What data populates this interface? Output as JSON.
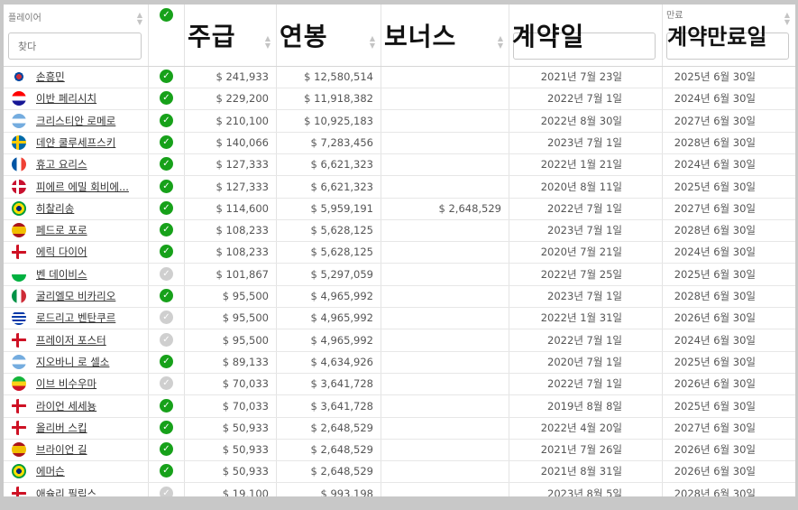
{
  "headers": {
    "player": "플레이어",
    "weekly": "주급",
    "annual": "연봉",
    "bonus": "보너스",
    "contract": "계약일",
    "expiry_small": "만료",
    "expiry": "계약만료일",
    "search_placeholder": "찾다"
  },
  "check_icon": "✓",
  "flag_colors": {
    "kr": [
      "#ffffff",
      "#cd2e3a",
      "#0047a0"
    ],
    "hr": [
      "#ff0000",
      "#ffffff",
      "#171796"
    ],
    "ar": [
      "#74acdf",
      "#ffffff",
      "#74acdf"
    ],
    "se": [
      "#006aa7",
      "#fecc00",
      "#006aa7"
    ],
    "fr": [
      "#0055a4",
      "#ffffff",
      "#ef4135"
    ],
    "dk": [
      "#c8102e",
      "#ffffff",
      "#c8102e"
    ],
    "br": [
      "#009c3b",
      "#ffdf00",
      "#002776"
    ],
    "es": [
      "#aa151b",
      "#f1bf00",
      "#aa151b"
    ],
    "en": [
      "#ffffff",
      "#ce1124",
      "#ffffff"
    ],
    "wl": [
      "#ffffff",
      "#00b140",
      "#d30731"
    ],
    "it": [
      "#009246",
      "#ffffff",
      "#ce2b37"
    ],
    "uy": [
      "#ffffff",
      "#0038a8",
      "#ffffff"
    ],
    "ml": [
      "#14b53a",
      "#fcd116",
      "#ce1126"
    ]
  },
  "rows": [
    {
      "flag": "kr",
      "name": "손흥민",
      "signed": true,
      "weekly": "$ 241,933",
      "annual": "$ 12,580,514",
      "bonus": "",
      "contract": "2021년 7월 23일",
      "expiry": "2025년 6월 30일"
    },
    {
      "flag": "hr",
      "name": "이반 페리시치",
      "signed": true,
      "weekly": "$ 229,200",
      "annual": "$ 11,918,382",
      "bonus": "",
      "contract": "2022년 7월 1일",
      "expiry": "2024년 6월 30일"
    },
    {
      "flag": "ar",
      "name": "크리스티안 로메로",
      "signed": true,
      "weekly": "$ 210,100",
      "annual": "$ 10,925,183",
      "bonus": "",
      "contract": "2022년 8월 30일",
      "expiry": "2027년 6월 30일"
    },
    {
      "flag": "se",
      "name": "데얀 쿨루세프스키",
      "signed": true,
      "weekly": "$ 140,066",
      "annual": "$ 7,283,456",
      "bonus": "",
      "contract": "2023년 7월 1일",
      "expiry": "2028년 6월 30일"
    },
    {
      "flag": "fr",
      "name": "휴고 요리스",
      "signed": true,
      "weekly": "$ 127,333",
      "annual": "$ 6,621,323",
      "bonus": "",
      "contract": "2022년 1월 21일",
      "expiry": "2024년 6월 30일"
    },
    {
      "flag": "dk",
      "name": "피에르 에밀 회비에...",
      "signed": true,
      "weekly": "$ 127,333",
      "annual": "$ 6,621,323",
      "bonus": "",
      "contract": "2020년 8월 11일",
      "expiry": "2025년 6월 30일"
    },
    {
      "flag": "br",
      "name": "히찰리송",
      "signed": true,
      "weekly": "$ 114,600",
      "annual": "$ 5,959,191",
      "bonus": "$ 2,648,529",
      "contract": "2022년 7월 1일",
      "expiry": "2027년 6월 30일"
    },
    {
      "flag": "es",
      "name": "페드로 포로",
      "signed": true,
      "weekly": "$ 108,233",
      "annual": "$ 5,628,125",
      "bonus": "",
      "contract": "2023년 7월 1일",
      "expiry": "2028년 6월 30일"
    },
    {
      "flag": "en",
      "name": "에릭 다이어",
      "signed": true,
      "weekly": "$ 108,233",
      "annual": "$ 5,628,125",
      "bonus": "",
      "contract": "2020년 7월 21일",
      "expiry": "2024년 6월 30일"
    },
    {
      "flag": "wl",
      "name": "벤 데이비스",
      "signed": false,
      "weekly": "$ 101,867",
      "annual": "$ 5,297,059",
      "bonus": "",
      "contract": "2022년 7월 25일",
      "expiry": "2025년 6월 30일"
    },
    {
      "flag": "it",
      "name": "굴리엘모 비카리오",
      "signed": true,
      "weekly": "$ 95,500",
      "annual": "$ 4,965,992",
      "bonus": "",
      "contract": "2023년 7월 1일",
      "expiry": "2028년 6월 30일"
    },
    {
      "flag": "uy",
      "name": "로드리고 벤탄쿠르",
      "signed": false,
      "weekly": "$ 95,500",
      "annual": "$ 4,965,992",
      "bonus": "",
      "contract": "2022년 1월 31일",
      "expiry": "2026년 6월 30일"
    },
    {
      "flag": "en",
      "name": "프레이저 포스터",
      "signed": false,
      "weekly": "$ 95,500",
      "annual": "$ 4,965,992",
      "bonus": "",
      "contract": "2022년 7월 1일",
      "expiry": "2024년 6월 30일"
    },
    {
      "flag": "ar",
      "name": "지오바니 로 셀소",
      "signed": true,
      "weekly": "$ 89,133",
      "annual": "$ 4,634,926",
      "bonus": "",
      "contract": "2020년 7월 1일",
      "expiry": "2025년 6월 30일"
    },
    {
      "flag": "ml",
      "name": "이브 비수우마",
      "signed": false,
      "weekly": "$ 70,033",
      "annual": "$ 3,641,728",
      "bonus": "",
      "contract": "2022년 7월 1일",
      "expiry": "2026년 6월 30일"
    },
    {
      "flag": "en",
      "name": "라이언 세세뇽",
      "signed": true,
      "weekly": "$ 70,033",
      "annual": "$ 3,641,728",
      "bonus": "",
      "contract": "2019년 8월 8일",
      "expiry": "2025년 6월 30일"
    },
    {
      "flag": "en",
      "name": "올리버 스킵",
      "signed": true,
      "weekly": "$ 50,933",
      "annual": "$ 2,648,529",
      "bonus": "",
      "contract": "2022년 4월 20일",
      "expiry": "2027년 6월 30일"
    },
    {
      "flag": "es",
      "name": "브라이언 길",
      "signed": true,
      "weekly": "$ 50,933",
      "annual": "$ 2,648,529",
      "bonus": "",
      "contract": "2021년 7월 26일",
      "expiry": "2026년 6월 30일"
    },
    {
      "flag": "br",
      "name": "에머슨",
      "signed": true,
      "weekly": "$ 50,933",
      "annual": "$ 2,648,529",
      "bonus": "",
      "contract": "2021년 8월 31일",
      "expiry": "2026년 6월 30일"
    },
    {
      "flag": "en",
      "name": "애슐리 필립스",
      "signed": false,
      "weekly": "$ 19,100",
      "annual": "$ 993,198",
      "bonus": "",
      "contract": "2023년 8월 5일",
      "expiry": "2028년 6월 30일"
    }
  ]
}
